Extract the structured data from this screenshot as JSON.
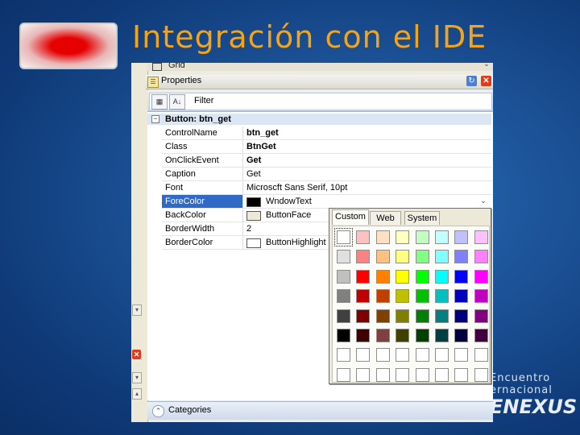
{
  "slide": {
    "title": "Integración con el IDE",
    "brand_line1": "Encuentro",
    "brand_line2": "ernacional",
    "brand_line3": "ENEXUS"
  },
  "ide": {
    "grid_label": "Grid",
    "props_title": "Properties",
    "filter_label": "Filter",
    "group_label": "Button: btn_get",
    "rows": [
      {
        "name": "ControlName",
        "value": "btn_get",
        "bold": true
      },
      {
        "name": "Class",
        "value": "BtnGet",
        "bold": true
      },
      {
        "name": "OnClickEvent",
        "value": "Get",
        "bold": true
      },
      {
        "name": "Caption",
        "value": "Get",
        "bold": false
      },
      {
        "name": "Font",
        "value": "Microscft Sans Serif, 10pt",
        "bold": false
      },
      {
        "name": "ForeColor",
        "value": "WndowText",
        "bold": false,
        "swatch": "#000000",
        "selected": true
      },
      {
        "name": "BackColor",
        "value": "ButtonFace",
        "bold": false,
        "swatch": "#ece9d8"
      },
      {
        "name": "BorderWidth",
        "value": "2",
        "bold": false
      },
      {
        "name": "BorderColor",
        "value": "ButtonHighlight",
        "bold": false,
        "swatch": "#ffffff"
      }
    ],
    "categories_label": "Categories"
  },
  "picker": {
    "tabs": [
      "Custom",
      "Web",
      "System"
    ],
    "active_tab": "Custom",
    "grid_colors": [
      [
        "#ffffff",
        "#ffc0c0",
        "#ffe0c0",
        "#ffffc0",
        "#c0ffc0",
        "#c0ffff",
        "#c0c0ff",
        "#ffc0ff"
      ],
      [
        "#e0e0e0",
        "#ff8080",
        "#ffc080",
        "#ffff80",
        "#80ff80",
        "#80ffff",
        "#8080ff",
        "#ff80ff"
      ],
      [
        "#c0c0c0",
        "#ff0000",
        "#ff8000",
        "#ffff00",
        "#00ff00",
        "#00ffff",
        "#0000ff",
        "#ff00ff"
      ],
      [
        "#808080",
        "#c00000",
        "#c04000",
        "#c0c000",
        "#00c000",
        "#00c0c0",
        "#0000c0",
        "#c000c0"
      ],
      [
        "#404040",
        "#800000",
        "#804000",
        "#808000",
        "#008000",
        "#008080",
        "#000080",
        "#800080"
      ],
      [
        "#000000",
        "#400000",
        "#804040",
        "#404000",
        "#004000",
        "#004040",
        "#000040",
        "#400040"
      ],
      [
        "#ffffff",
        "#ffffff",
        "#ffffff",
        "#ffffff",
        "#ffffff",
        "#ffffff",
        "#ffffff",
        "#ffffff"
      ],
      [
        "#ffffff",
        "#ffffff",
        "#ffffff",
        "#ffffff",
        "#ffffff",
        "#ffffff",
        "#ffffff",
        "#ffffff"
      ]
    ]
  }
}
